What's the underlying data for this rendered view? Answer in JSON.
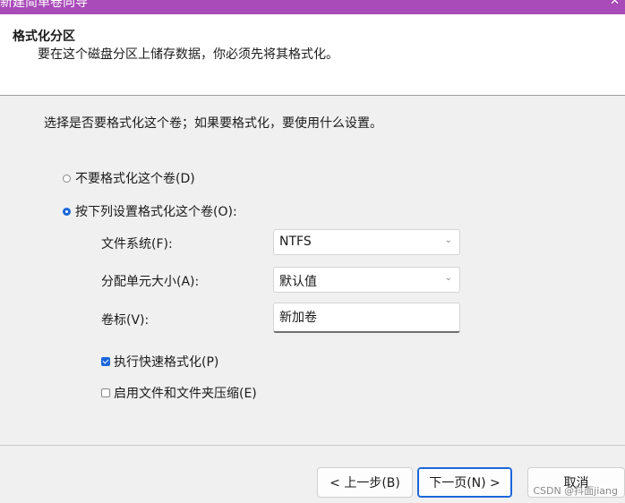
{
  "window": {
    "title": "新建简单卷向导",
    "close_glyph": "✕"
  },
  "header": {
    "title": "格式化分区",
    "subtitle": "要在这个磁盘分区上储存数据，你必须先将其格式化。"
  },
  "main": {
    "instruction": "选择是否要格式化这个卷；如果要格式化，要使用什么设置。",
    "option_no_format": "不要格式化这个卷(D)",
    "option_format": "按下列设置格式化这个卷(O):",
    "selected_option": "format",
    "file_system": {
      "label": "文件系统(F):",
      "value": "NTFS"
    },
    "allocation_unit": {
      "label": "分配单元大小(A):",
      "value": "默认值"
    },
    "volume_label": {
      "label": "卷标(V):",
      "value": "新加卷"
    },
    "quick_format": {
      "label": "执行快速格式化(P)",
      "checked": true
    },
    "compression": {
      "label": "启用文件和文件夹压缩(E)",
      "checked": false
    },
    "chevron_icon": "chevron-down-icon",
    "chevron_glyph": "⌄"
  },
  "footer": {
    "back_label": "< 上一步(B)",
    "next_label": "下一页(N) >",
    "cancel_label": "取消",
    "watermark": "CSDN @抖面jiang"
  },
  "colors": {
    "titlebar": "#a94bb9",
    "accent": "#1a66d9"
  }
}
